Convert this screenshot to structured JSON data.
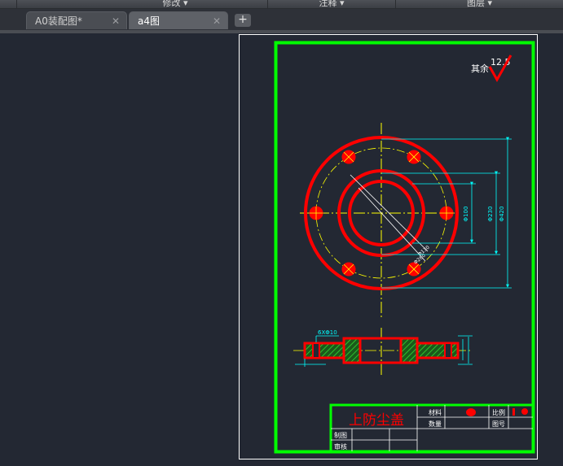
{
  "ribbon": {
    "panels": [
      {
        "label": "修改 ▾"
      },
      {
        "label": "注释 ▾"
      },
      {
        "label": "图层 ▾"
      }
    ]
  },
  "tabs": [
    {
      "label": "A0装配图*",
      "close": "✕",
      "active": false
    },
    {
      "label": "a4图",
      "close": "✕",
      "active": true
    }
  ],
  "new_tab": "+",
  "colors": {
    "background": "#232833",
    "frame": "#00ff00",
    "part": "#ff0000",
    "dimension": "#00ffff",
    "centerline": "#ffff00"
  },
  "drawing": {
    "roughness_label": "其余",
    "roughness_value": "12.5",
    "dim_diameters": [
      "Φ100",
      "Φ230",
      "Φ420"
    ],
    "radial_dims": [
      "Φ130",
      "Φ260"
    ],
    "hole_spec": "6XΦ10",
    "title_block": {
      "part_name": "上防尘盖",
      "material_label": "材料",
      "quantity_label": "数量",
      "scale_label": "比例",
      "drawing_no_label": "图号",
      "drawn_label": "制图",
      "checked_label": "审核"
    }
  }
}
